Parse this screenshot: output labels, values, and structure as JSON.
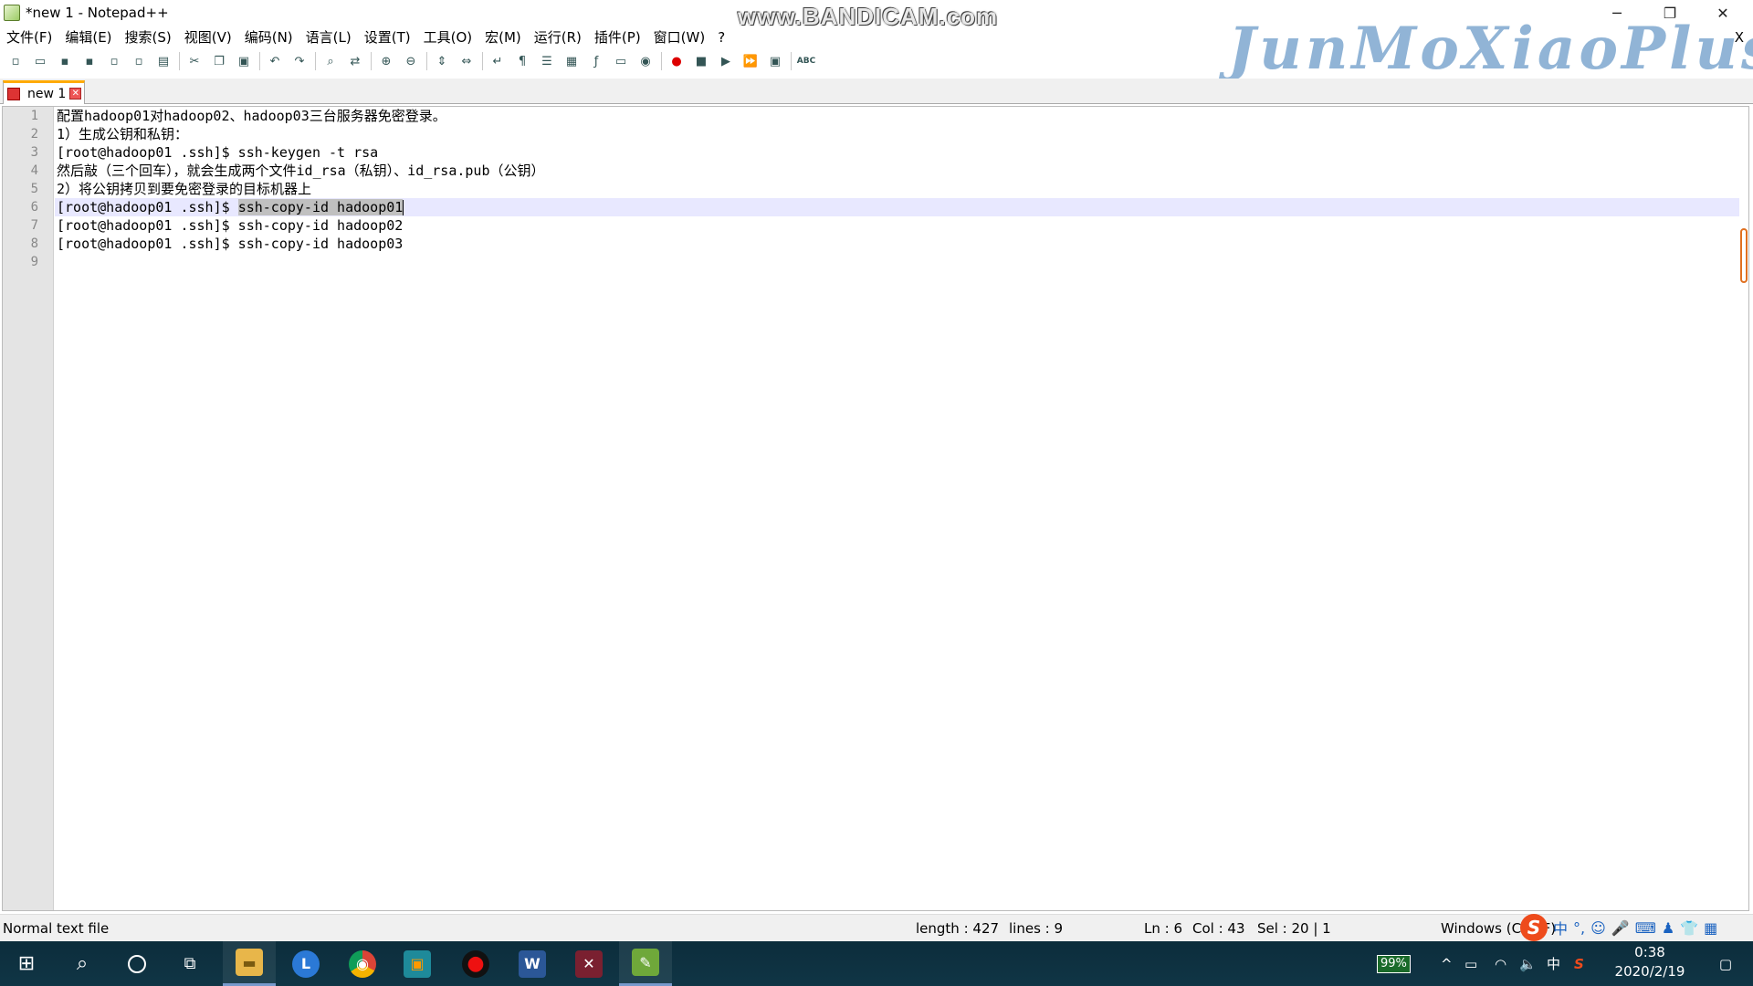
{
  "window": {
    "title": "*new 1 - Notepad++",
    "watermark": "www.BANDICAM.com",
    "minimize": "─",
    "restore": "❐",
    "close": "✕"
  },
  "logo": "JunMoXiaoPlus",
  "menu": {
    "items": [
      "文件(F)",
      "编辑(E)",
      "搜索(S)",
      "视图(V)",
      "编码(N)",
      "语言(L)",
      "设置(T)",
      "工具(O)",
      "宏(M)",
      "运行(R)",
      "插件(P)",
      "窗口(W)",
      "?"
    ],
    "close_doc": "X"
  },
  "toolbar": {
    "icons": [
      "new-file-icon",
      "open-file-icon",
      "save-icon",
      "save-all-icon",
      "close-icon",
      "close-all-icon",
      "print-icon",
      "cut-icon",
      "copy-icon",
      "paste-icon",
      "undo-icon",
      "redo-icon",
      "find-icon",
      "replace-icon",
      "zoom-in-icon",
      "zoom-out-icon",
      "sync-v-icon",
      "sync-h-icon",
      "word-wrap-icon",
      "show-all-chars-icon",
      "indent-guide-icon",
      "doc-map-icon",
      "function-list-icon",
      "folder-workspace-icon",
      "monitoring-icon",
      "record-macro-icon",
      "stop-macro-icon",
      "play-macro-icon",
      "run-macro-multiple-icon",
      "save-macro-icon",
      "spell-check-icon"
    ]
  },
  "tabs": [
    {
      "label": "new 1",
      "close": "✕"
    }
  ],
  "editor": {
    "line_numbers": [
      "1",
      "2",
      "3",
      "4",
      "5",
      "6",
      "7",
      "8",
      "9"
    ],
    "lines": [
      "配置hadoop01对hadoop02、hadoop03三台服务器免密登录。",
      "1）生成公钥和私钥：",
      "[root@hadoop01 .ssh]$ ssh-keygen -t rsa",
      "然后敲（三个回车），就会生成两个文件id_rsa（私钥）、id_rsa.pub（公钥）",
      "2）将公钥拷贝到要免密登录的目标机器上",
      "[root@hadoop01 .ssh]$ ",
      "[root@hadoop01 .ssh]$ ssh-copy-id hadoop02",
      "[root@hadoop01 .ssh]$ ssh-copy-id hadoop03",
      ""
    ],
    "selected_text": "ssh-copy-id hadoop01"
  },
  "status": {
    "file_type": "Normal text file",
    "length": "length : 427",
    "lines": "lines : 9",
    "ln": "Ln : 6",
    "col": "Col : 43",
    "sel": "Sel : 20 | 1",
    "eol": "Windows (CR LF)"
  },
  "ime": {
    "logo": "S",
    "lang": "中",
    "punct": "°,",
    "emoji": "☺",
    "mic": "🎤",
    "keyboard": "⌨",
    "user": "♟",
    "skin": "👕",
    "tools": "▦"
  },
  "taskbar": {
    "start": "⊞",
    "search": "⌕",
    "taskview": "⧉",
    "apps": [
      {
        "name": "file-explorer",
        "color": "#e8b64a",
        "glyph": "▬"
      },
      {
        "name": "clock-app",
        "color": "#2b79d6",
        "glyph": "L"
      },
      {
        "name": "chrome",
        "color": "#3b8a3e",
        "glyph": "◉"
      },
      {
        "name": "vmware",
        "color": "#1e8a9a",
        "glyph": "▣"
      },
      {
        "name": "recorder",
        "color": "#d11",
        "glyph": "●"
      },
      {
        "name": "word",
        "color": "#2b5797",
        "glyph": "W"
      },
      {
        "name": "photo-editor",
        "color": "#7a2030",
        "glyph": "✕"
      },
      {
        "name": "notepad-plus-plus",
        "color": "#6fa83a",
        "glyph": "✎"
      }
    ],
    "battery": "99%",
    "chevron": "^",
    "power": "▭",
    "wifi": "◠",
    "volume": "🔈",
    "lang": "中",
    "ime": "S",
    "time": "0:38",
    "date": "2020/2/19",
    "notification": "▢"
  }
}
